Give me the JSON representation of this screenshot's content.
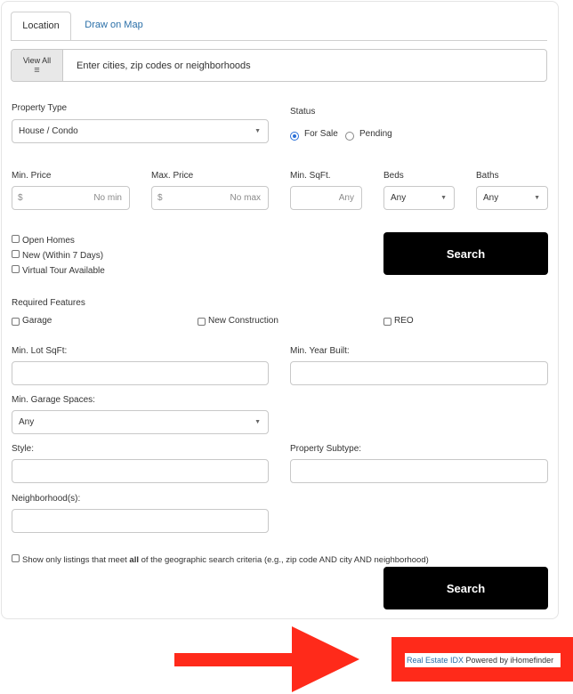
{
  "tabs": [
    {
      "label": "Location"
    },
    {
      "label": "Draw on Map"
    }
  ],
  "location": {
    "view_all_label": "View All",
    "view_all_icon": "list-icon",
    "placeholder": "Enter cities, zip codes or neighborhoods"
  },
  "property_type": {
    "label": "Property Type",
    "value": "House / Condo"
  },
  "status": {
    "label": "Status",
    "options": [
      {
        "label": "For Sale",
        "selected": true
      },
      {
        "label": "Pending",
        "selected": false
      }
    ]
  },
  "min_price": {
    "label": "Min. Price",
    "currency": "$",
    "placeholder": "No min"
  },
  "max_price": {
    "label": "Max. Price",
    "currency": "$",
    "placeholder": "No max"
  },
  "min_sqft": {
    "label": "Min. SqFt.",
    "placeholder": "Any"
  },
  "beds": {
    "label": "Beds",
    "value": "Any"
  },
  "baths": {
    "label": "Baths",
    "value": "Any"
  },
  "filters": [
    {
      "label": "Open Homes",
      "checked": false
    },
    {
      "label": "New (Within 7 Days)",
      "checked": false
    },
    {
      "label": "Virtual Tour Available",
      "checked": false
    }
  ],
  "search_label": "Search",
  "required_features": {
    "label": "Required Features",
    "options": [
      {
        "label": "Garage",
        "checked": false
      },
      {
        "label": "New Construction",
        "checked": false
      },
      {
        "label": "REO",
        "checked": false
      }
    ]
  },
  "min_lot_sqft": {
    "label": "Min. Lot SqFt:"
  },
  "min_year_built": {
    "label": "Min. Year Built:"
  },
  "min_garage_spaces": {
    "label": "Min. Garage Spaces:",
    "value": "Any"
  },
  "style": {
    "label": "Style:"
  },
  "property_subtype": {
    "label": "Property Subtype:"
  },
  "neighborhoods": {
    "label": "Neighborhood(s):"
  },
  "geo_criteria": {
    "prefix": "Show only listings that meet ",
    "emphasis": "all",
    "suffix": " of the geographic search criteria (e.g., zip code AND city AND neighborhood)",
    "checked": false
  },
  "footer": {
    "link_text": "Real Estate IDX",
    "powered_by": " Powered by iHomefinder"
  },
  "colors": {
    "annotation": "#ff2a1a",
    "link": "#2a6fa8",
    "button": "#000000"
  }
}
